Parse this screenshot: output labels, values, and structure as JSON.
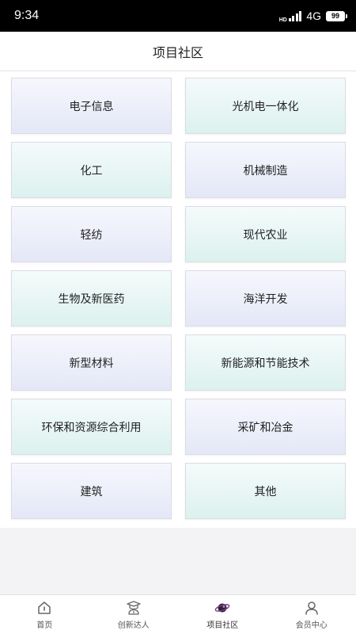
{
  "status_bar": {
    "time": "9:34",
    "hd": "HD",
    "network": "4G",
    "battery": "99"
  },
  "header": {
    "title": "项目社区"
  },
  "categories": [
    {
      "label": "电子信息",
      "style": "lavender"
    },
    {
      "label": "光机电一体化",
      "style": "mint"
    },
    {
      "label": "化工",
      "style": "mint"
    },
    {
      "label": "机械制造",
      "style": "lavender"
    },
    {
      "label": "轻纺",
      "style": "lavender"
    },
    {
      "label": "现代农业",
      "style": "mint"
    },
    {
      "label": "生物及新医药",
      "style": "mint"
    },
    {
      "label": "海洋开发",
      "style": "lavender"
    },
    {
      "label": "新型材料",
      "style": "lavender"
    },
    {
      "label": "新能源和节能技术",
      "style": "mint"
    },
    {
      "label": "环保和资源综合利用",
      "style": "mint"
    },
    {
      "label": "采矿和冶金",
      "style": "lavender"
    },
    {
      "label": "建筑",
      "style": "lavender"
    },
    {
      "label": "其他",
      "style": "mint"
    }
  ],
  "tabbar": {
    "items": [
      {
        "label": "首页",
        "icon": "home-icon"
      },
      {
        "label": "创新达人",
        "icon": "graduate-icon"
      },
      {
        "label": "项目社区",
        "icon": "planet-icon",
        "active": true
      },
      {
        "label": "会员中心",
        "icon": "user-icon"
      }
    ]
  },
  "colors": {
    "tile_lavender": "#e4e7f7",
    "tile_mint": "#dcf1ee",
    "active_tab_accent": "#7b3a8c"
  }
}
